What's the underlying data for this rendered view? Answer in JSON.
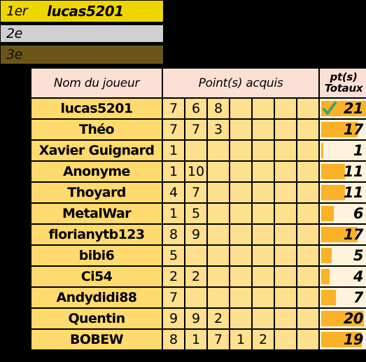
{
  "podium": {
    "rows": [
      {
        "rank": "1er",
        "name": "lucas5201",
        "color": "#EED600"
      },
      {
        "rank": "2e",
        "name": "",
        "color": "#D0D0D0"
      },
      {
        "rank": "3e",
        "name": "",
        "color": "#6B5519"
      }
    ]
  },
  "table": {
    "headers": {
      "name": "Nom du joueur",
      "points": "Point(s) acquis",
      "total_line1": "pt(s)",
      "total_line2": "Totaux"
    },
    "point_column_count": 7,
    "max_total": 21,
    "colors": {
      "name_cell": "#FFDA6E",
      "point_cell": "#FFE08E",
      "total_cell": "#FFF3DC",
      "bar_fill": "#FBB229",
      "header": "#FCE0D6",
      "check": "#3FA463"
    },
    "rows": [
      {
        "name": "lucas5201",
        "points": [
          "7",
          "6",
          "8",
          "",
          "",
          "",
          ""
        ],
        "total": "21",
        "total_value": 21,
        "leader": true
      },
      {
        "name": "Théo",
        "points": [
          "7",
          "7",
          "3",
          "",
          "",
          "",
          ""
        ],
        "total": "17",
        "total_value": 17,
        "leader": false
      },
      {
        "name": "Xavier Guignard",
        "points": [
          "1",
          "",
          "",
          "",
          "",
          "",
          ""
        ],
        "total": "1",
        "total_value": 1,
        "leader": false
      },
      {
        "name": "Anonyme",
        "points": [
          "1",
          "10",
          "",
          "",
          "",
          "",
          ""
        ],
        "total": "11",
        "total_value": 11,
        "leader": false
      },
      {
        "name": "Thoyard",
        "points": [
          "4",
          "7",
          "",
          "",
          "",
          "",
          ""
        ],
        "total": "11",
        "total_value": 11,
        "leader": false
      },
      {
        "name": "MetalWar",
        "points": [
          "1",
          "5",
          "",
          "",
          "",
          "",
          ""
        ],
        "total": "6",
        "total_value": 6,
        "leader": false
      },
      {
        "name": "florianytb123",
        "points": [
          "8",
          "9",
          "",
          "",
          "",
          "",
          ""
        ],
        "total": "17",
        "total_value": 17,
        "leader": false
      },
      {
        "name": "bibi6",
        "points": [
          "5",
          "",
          "",
          "",
          "",
          "",
          ""
        ],
        "total": "5",
        "total_value": 5,
        "leader": false
      },
      {
        "name": "Ci54",
        "points": [
          "2",
          "2",
          "",
          "",
          "",
          "",
          ""
        ],
        "total": "4",
        "total_value": 4,
        "leader": false
      },
      {
        "name": "Andydidi88",
        "points": [
          "7",
          "",
          "",
          "",
          "",
          "",
          ""
        ],
        "total": "7",
        "total_value": 7,
        "leader": false
      },
      {
        "name": "Quentin",
        "points": [
          "9",
          "9",
          "2",
          "",
          "",
          "",
          ""
        ],
        "total": "20",
        "total_value": 20,
        "leader": false
      },
      {
        "name": "BOBEW",
        "points": [
          "8",
          "1",
          "7",
          "1",
          "2",
          "",
          ""
        ],
        "total": "19",
        "total_value": 19,
        "leader": false
      }
    ]
  }
}
